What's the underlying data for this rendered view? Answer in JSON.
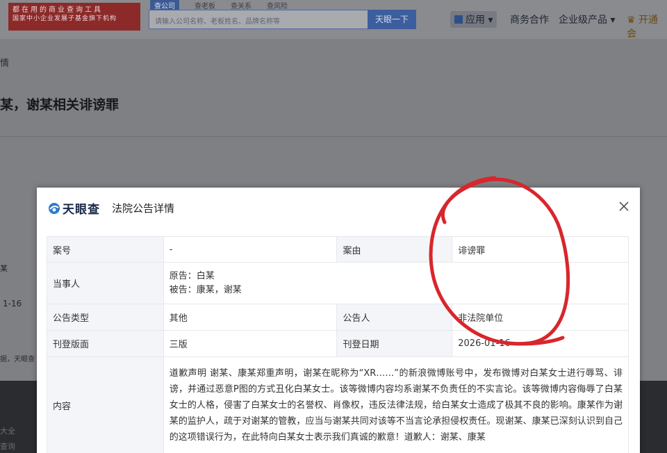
{
  "header": {
    "logo_line1": "都在用的商业查询工具",
    "logo_line2": "国家中小企业发展子基金旗下机构",
    "search_tabs": [
      "查公司",
      "查老板",
      "查关系",
      "查风险"
    ],
    "search_placeholder": "请输入公司名称、老板姓名、品牌名称等",
    "search_button": "天眼一下",
    "nav_app": "应用",
    "nav_business": "商务合作",
    "nav_products": "企业级产品",
    "nav_vip": "开通会"
  },
  "background": {
    "breadcrumb": "情",
    "title": "某，谢某相关诽谤罪",
    "side_text_1": "某",
    "side_text_2": "1-16",
    "side_text_3": "据，天眼查",
    "footer_1": "大全",
    "footer_2": "查询"
  },
  "modal": {
    "brand": "天眼查",
    "title": "法院公告详情",
    "rows": {
      "case_no_label": "案号",
      "case_no_value": "-",
      "cause_label": "案由",
      "cause_value": "诽谤罪",
      "party_label": "当事人",
      "plaintiff": "原告：白某",
      "defendant": "被告：康某，谢某",
      "type_label": "公告类型",
      "type_value": "其他",
      "announcer_label": "公告人",
      "announcer_value": "非法院单位",
      "page_label": "刊登版面",
      "page_value": "三版",
      "date_label": "刊登日期",
      "date_value": "2026-01-16",
      "content_label": "内容",
      "content_value": "道歉声明 谢某、康某郑重声明，谢某在昵称为“XR……”的新浪微博账号中，发布微博对白某女士进行辱骂、诽谤，并通过恶意P图的方式丑化白某女士。该等微博内容均系谢某不负责任的不实言论。该等微博内容侮辱了白某女士的人格，侵害了白某女士的名誉权、肖像权，违反法律法规，给白某女士造成了极其不良的影响。康某作为谢某的监护人，疏于对谢某的管教，应当与谢某共同对该等不当言论承担侵权责任。现谢某、康某已深刻认识到自己的这项错误行为，在此特向白某女士表示我们真诚的歉意！道歉人：谢某、康某"
    }
  },
  "colors": {
    "annotation_red": "#d8262c",
    "brand_blue": "#2a7ad0",
    "overlay": "#7f8084"
  }
}
